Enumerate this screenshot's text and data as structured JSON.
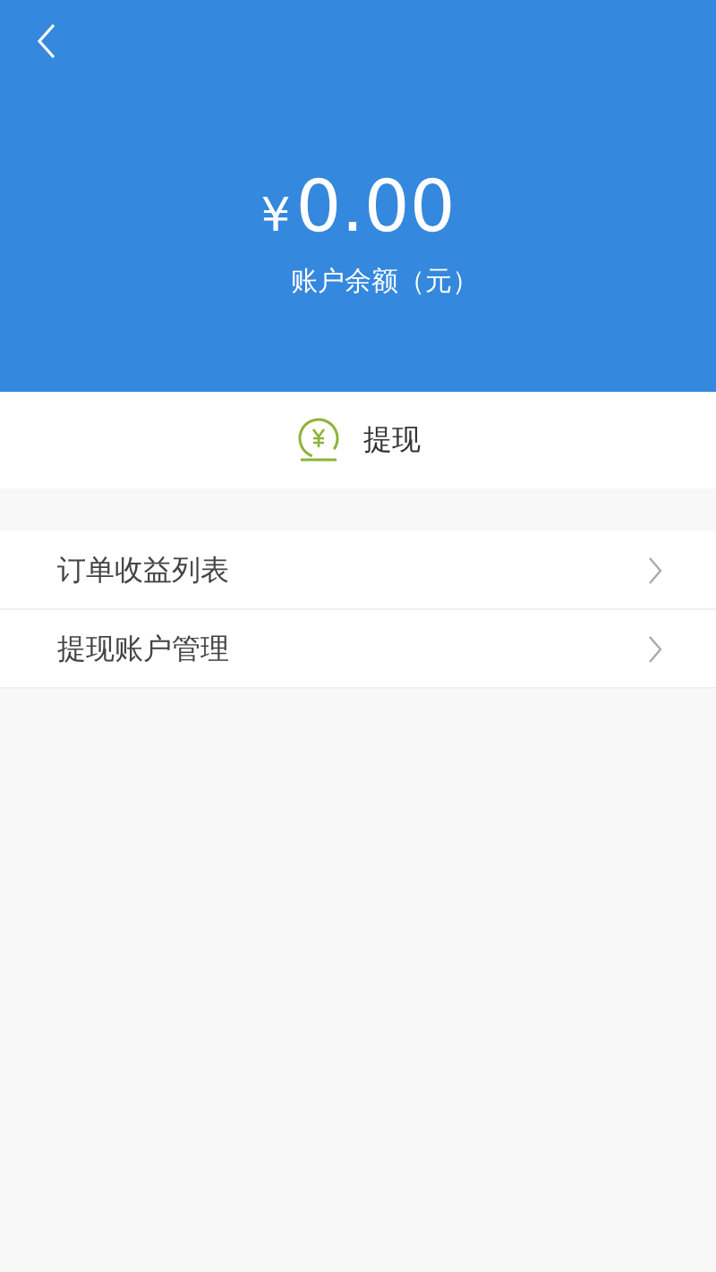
{
  "header": {
    "currency": "¥",
    "balance": "0.00",
    "caption": "账户余额（元）"
  },
  "withdraw_button": {
    "label": "提现"
  },
  "menu": [
    {
      "label": "订单收益列表"
    },
    {
      "label": "提现账户管理"
    }
  ]
}
